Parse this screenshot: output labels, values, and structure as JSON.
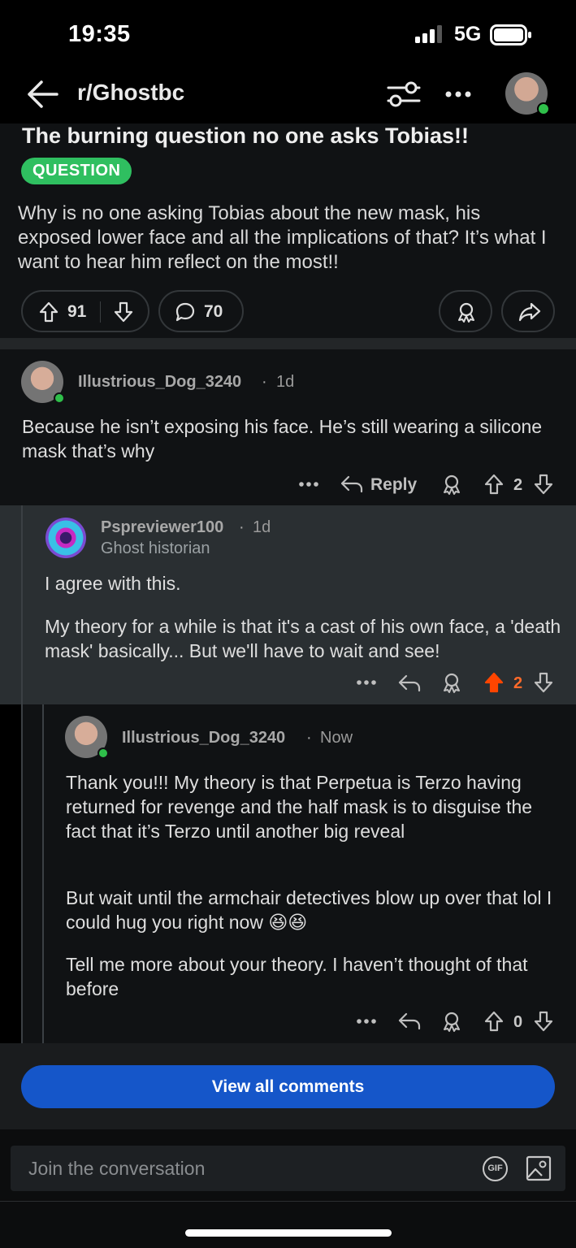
{
  "status_bar": {
    "time": "19:35",
    "network": "5G"
  },
  "header": {
    "title": "r/Ghostbc"
  },
  "post": {
    "title": "The burning question no one asks Tobias!!",
    "flair": "QUESTION",
    "body": "Why is no one asking Tobias about the new mask, his exposed lower face and all the implications of that? It’s what I want to hear him reflect on the most!!",
    "upvotes": "91",
    "comments": "70"
  },
  "comments": [
    {
      "author": "Illustrious_Dog_3240",
      "time": "1d",
      "body": "Because he isn’t exposing his face. He’s still wearing a silicone mask that’s why",
      "reply_label": "Reply",
      "score": "2"
    },
    {
      "author": "Pspreviewer100",
      "time": "1d",
      "user_flair": "Ghost historian",
      "body_p1": "I agree with this.",
      "body_p2": "My theory for a while is that it's a cast of his own face, a 'death mask' basically... But we'll have to wait and see!",
      "score": "2",
      "upvoted_color": "#ff4500"
    },
    {
      "author": "Illustrious_Dog_3240",
      "time": "Now",
      "body_p1": "Thank you!!! My theory is that Perpetua is Terzo having returned for revenge and the half mask is to disguise the fact that it’s Terzo until another big reveal",
      "body_p2": "But wait until the armchair detectives blow up over that lol I could hug you right now 😆😆",
      "body_p3": "Tell me more about your theory. I haven’t thought of that before",
      "score": "0"
    }
  ],
  "view_all_label": "View all comments",
  "composer": {
    "placeholder": "Join the conversation",
    "gif_label": "GIF"
  },
  "colors": {
    "accent": "#1556c9",
    "flair": "#2fbf60",
    "online": "#2fbf4a"
  }
}
